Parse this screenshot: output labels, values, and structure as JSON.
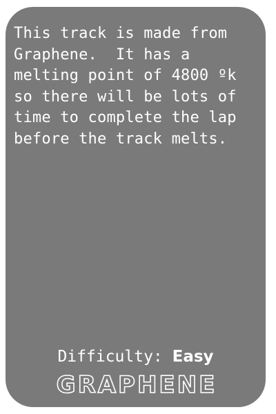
{
  "card": {
    "description": "This track is made from\nGraphene.  It has a\nmelting point of 4800 ºk\nso there will be lots of\ntime to complete the lap\nbefore the track melts.",
    "difficulty_label": "Difficulty: ",
    "difficulty_value": "Easy",
    "logo_text": "GRAPHENE"
  },
  "colors": {
    "card_background": "#7a7a7a",
    "text": "#ffffff"
  }
}
